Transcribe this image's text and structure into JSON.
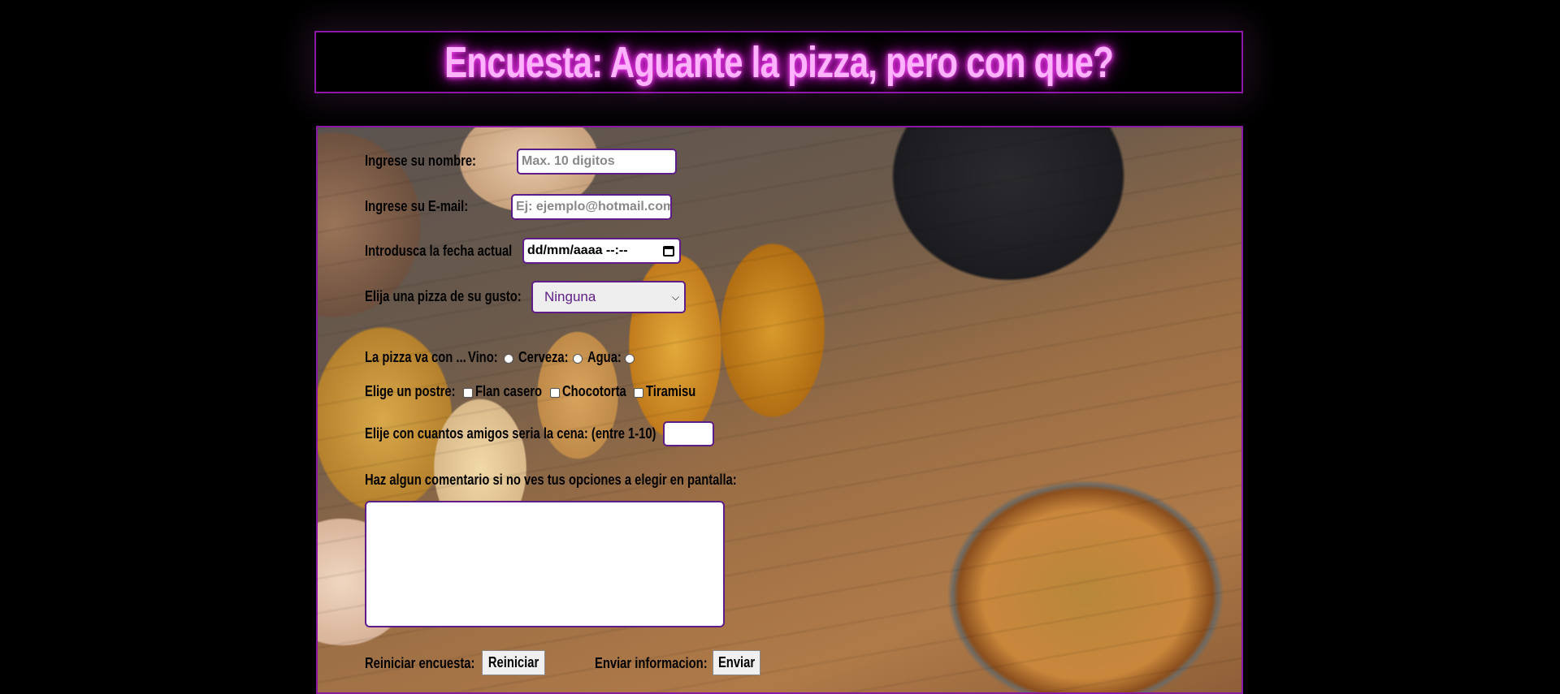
{
  "header": {
    "title": "Encuesta: Aguante la pizza, pero con que?"
  },
  "form": {
    "name": {
      "label": "Ingrese su nombre:",
      "placeholder": "Max. 10 digitos"
    },
    "email": {
      "label": "Ingrese su E-mail:",
      "placeholder": "Ej: ejemplo@hotmail.com"
    },
    "date": {
      "label": "Introdusca la fecha actual",
      "value": "dd/mm/aaaa --:--"
    },
    "pizza": {
      "label": "Elija una pizza de su gusto:",
      "selected": "Ninguna"
    },
    "drink": {
      "label": "La pizza va con ...",
      "options": [
        "Vino:",
        "Cerveza:",
        "Agua:"
      ]
    },
    "dessert": {
      "label": "Elige un postre:",
      "options": [
        "Flan casero",
        "Chocotorta",
        "Tiramisu"
      ]
    },
    "friends": {
      "label": "Elije con cuantos amigos seria la cena: (entre 1-10)",
      "value": ""
    },
    "comment": {
      "label": "Haz algun comentario si no ves tus opciones a elegir en pantalla:",
      "value": ""
    },
    "reset": {
      "label": "Reiniciar encuesta:",
      "button": "Reiniciar"
    },
    "submit": {
      "label": "Enviar informacion:",
      "button": "Enviar"
    }
  },
  "colors": {
    "background": "#000000",
    "accent_border": "#8b17a6",
    "title_glow": "#ff4dff",
    "field_border": "#5e1d86"
  }
}
